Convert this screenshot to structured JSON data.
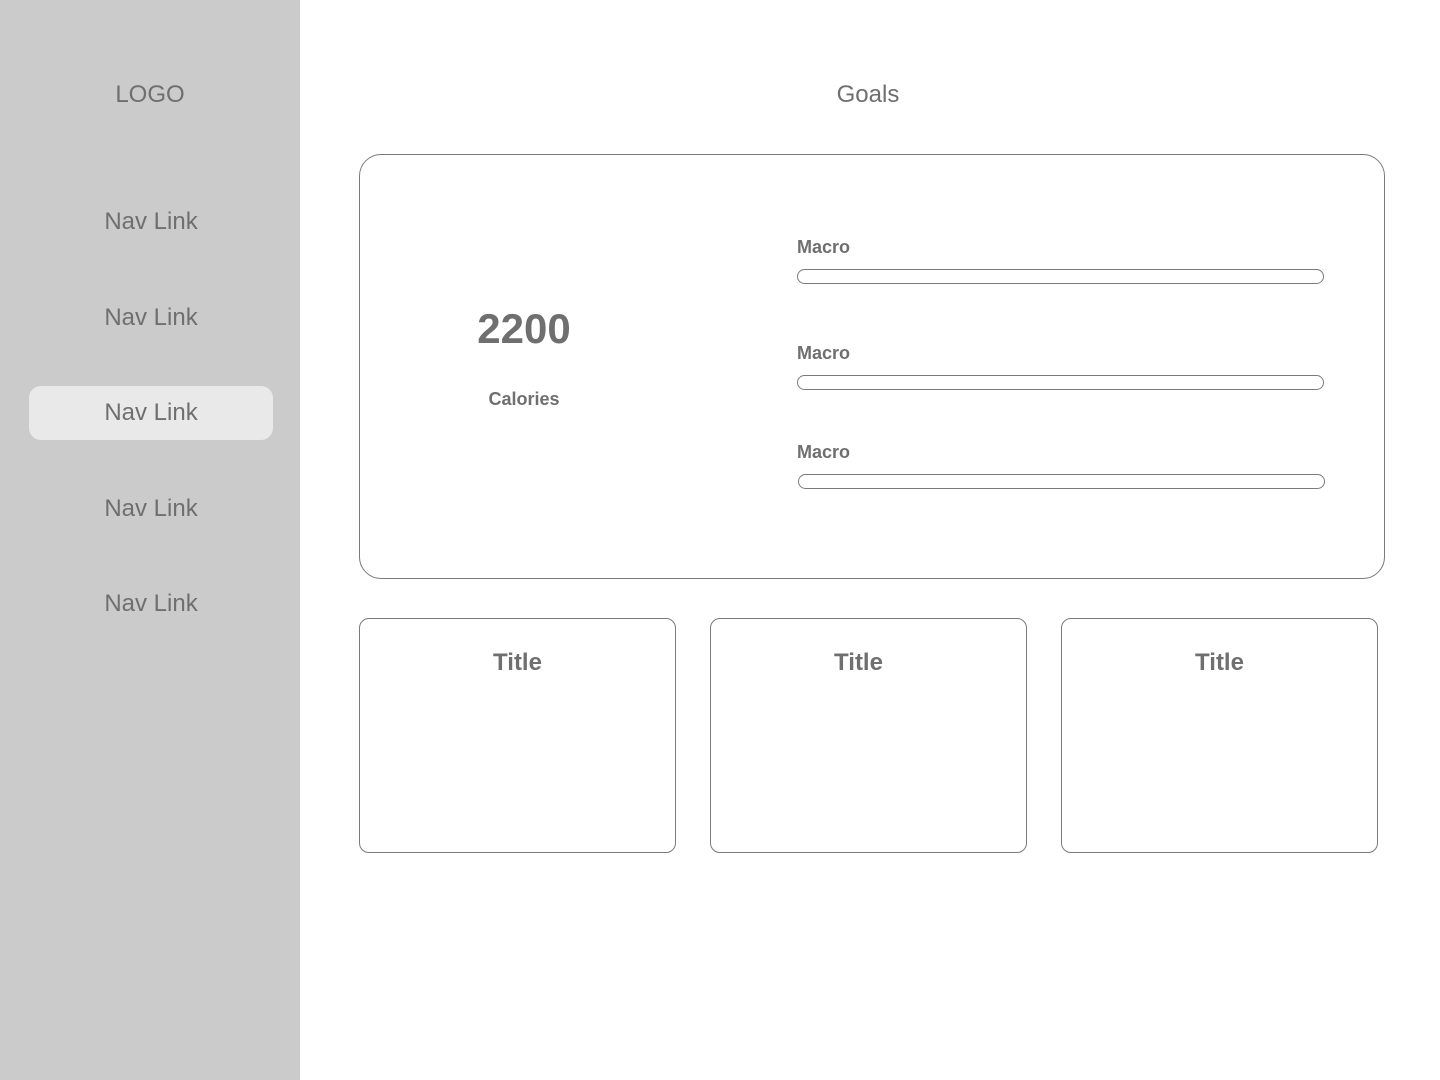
{
  "sidebar": {
    "logo": "LOGO",
    "nav": [
      {
        "label": "Nav Link",
        "active": false
      },
      {
        "label": "Nav Link",
        "active": false
      },
      {
        "label": "Nav Link",
        "active": true
      },
      {
        "label": "Nav Link",
        "active": false
      },
      {
        "label": "Nav Link",
        "active": false
      }
    ]
  },
  "main": {
    "title": "Goals",
    "calories": {
      "value": "2200",
      "label": "Calories"
    },
    "macros": [
      {
        "label": "Macro",
        "progress": 0
      },
      {
        "label": "Macro",
        "progress": 0
      },
      {
        "label": "Macro",
        "progress": 0
      }
    ],
    "cards": [
      {
        "title": "Title"
      },
      {
        "title": "Title"
      },
      {
        "title": "Title"
      }
    ]
  },
  "colors": {
    "sidebar_bg": "#cbcbcb",
    "active_nav_bg": "#e9e9e9",
    "text": "#6f6f6f",
    "border": "#7a7a7a"
  }
}
